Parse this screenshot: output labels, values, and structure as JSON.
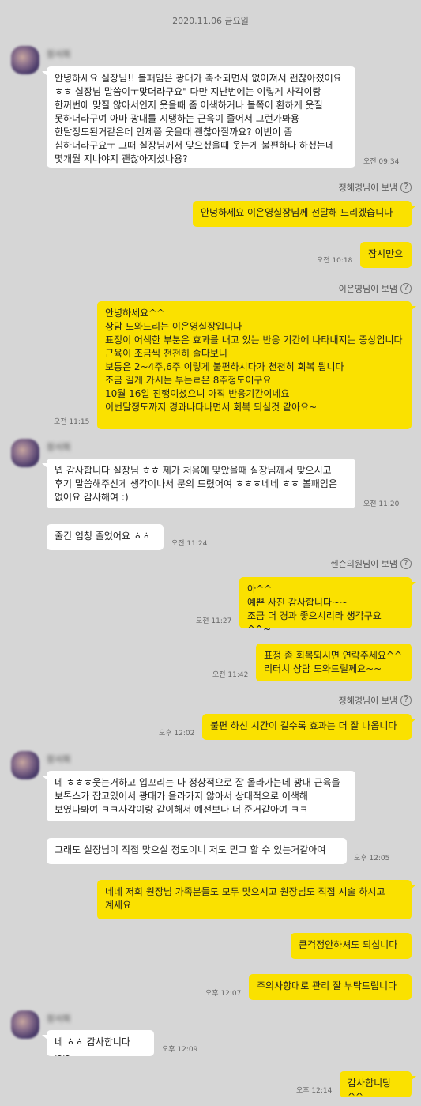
{
  "date_separator": "2020.11.06 금요일",
  "sent_by": {
    "jeonghye": "정혜경님이 보냄",
    "eunyoung": "이은영님이 보냄",
    "hyunseum": "헨슨의원님이 보냄"
  },
  "help_icon_glyph": "?",
  "contact_name": "장서희",
  "colors": {
    "background": "#d6d6d6",
    "outgoing": "#fae100",
    "incoming": "#ffffff"
  },
  "messages": [
    {
      "text": "안녕하세요 실장님!! 볼패임은 광대가 축소되면서 없어져서 괜찮아졌어요 ㅎㅎ 실장님 말씀이ㅜ맞더라구요\" 다만 지난번에는 이렇게 사각이랑 한꺼번에 맞질 않아서인지 웃을때 좀 어색하거나 볼쪽이 환하게 웃질 못하더라구여 아마 광대를 지탱하는 근육이 줄어서 그런가봐용 한달정도된거같은데 언제쯤 웃을때 괜찮아질까요? 이번이 좀 심하더라구요ㅜ 그때 실장님께서 맞으셨을때 웃는게 불편하다 하셨는데 몇개월 지나야지 괜찮아지셨나용?",
      "time": "오전 09:34"
    },
    {
      "text": "안녕하세요 이은영실장님께 전달해 드리겠습니다",
      "time": ""
    },
    {
      "text": "잠시만요",
      "time": "오전 10:18"
    },
    {
      "text": "안녕하세요^^\n상담 도와드리는 이은영실장입니다\n표정이 어색한 부분은 효과를 내고 있는 반응 기간에 나타내지는 증상입니다\n근육이 조금씩 천천히 줄다보니\n보통은 2~4주,6주 이렇게 불편하시다가 천천히 회복 됩니다\n조금 길게 가시는 부는ㄹ은 8주정도이구요\n10월 16일 진행이셨으니 아직 반응기간이네요\n이번달정도까지 경과나타나면서 회복 되실것 같아요~",
      "time": "오전 11:15"
    },
    {
      "text": "넵 감사합니다 실장님 ㅎㅎ 제가 처음에 맞았을때 실장님께서 맞으시고 후기 말씀해주신게 생각이나서 문의 드렸어여 ㅎㅎㅎ네네 ㅎㅎ 볼패임은 없어요 감사해여 :)",
      "time": "오전 11:20"
    },
    {
      "text": "줄긴 엄청 줄었어요 ㅎㅎ",
      "time": "오전 11:24"
    },
    {
      "text": "아^^\n예쁜 사진 감사합니다~~\n조금 더 경과 좋으시리라 생각구요^^~",
      "time": "오전 11:27"
    },
    {
      "text": "표정 좀 회복되시면 연락주세요^^\n리터치 상담 도와드릴께요~~",
      "time": "오전 11:42"
    },
    {
      "text": "불편 하신 시간이 길수록 효과는 더 잘 나옵니다",
      "time": "오후 12:02"
    },
    {
      "text": "네 ㅎㅎㅎ웃는거하고 입꼬리는 다 정상적으로 잘 올라가는데 광대 근육을 보톡스가 잡고있어서 광대가 올라가지 않아서 상대적으로 어색해 보였나봐여 ㅋㅋ사각이랑 같이해서 예전보다 더 준거같아여 ㅋㅋ",
      "time": ""
    },
    {
      "text": "그래도 실장님이 직접 맞으실 정도이니 저도 믿고 할 수 있는거같아여",
      "time": "오후 12:05"
    },
    {
      "text": "네네 저희 원장님 가족분들도 모두 맞으시고 원장님도 직접 시술 하시고 계세요",
      "time": ""
    },
    {
      "text": "큰걱정안하셔도 되십니다",
      "time": ""
    },
    {
      "text": "주의사항대로 관리 잘 부탁드립니다",
      "time": "오후 12:07"
    },
    {
      "text": "네 ㅎㅎ 감사합니다~~",
      "time": "오후 12:09"
    },
    {
      "text": "감사합니당^^",
      "time": "오후 12:14"
    }
  ]
}
